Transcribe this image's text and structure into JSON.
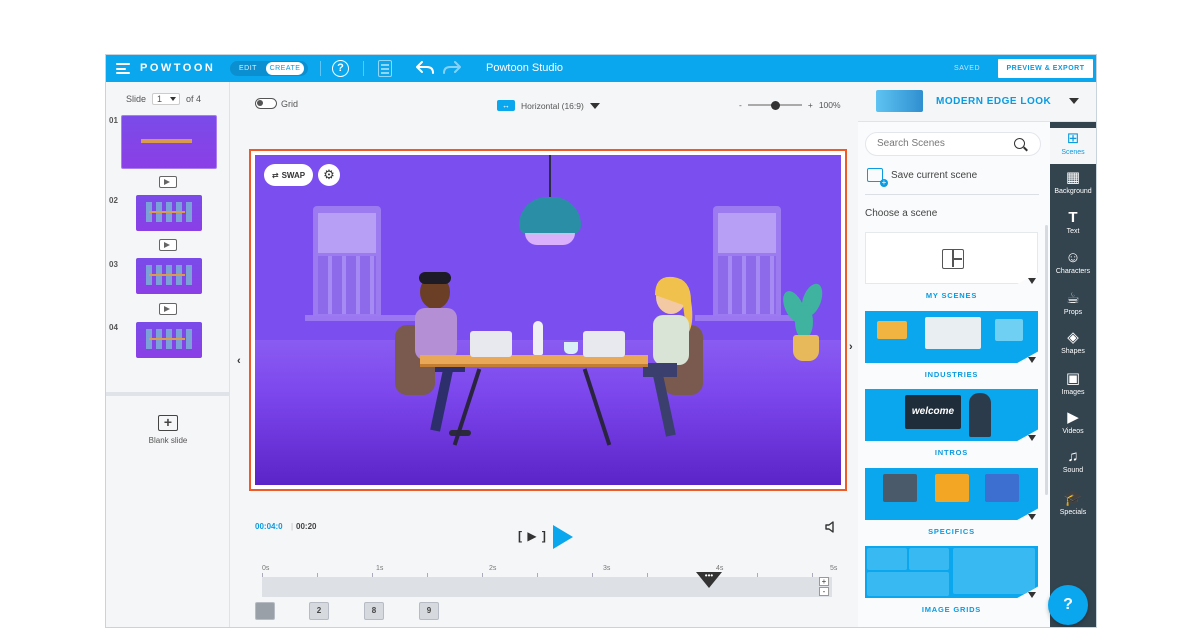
{
  "topbar": {
    "logo": "POWTOON",
    "mode_edit": "EDIT",
    "mode_create": "CREATE",
    "title": "Powtoon Studio",
    "saved": "SAVED",
    "export": "PREVIEW & EXPORT"
  },
  "slides_panel": {
    "label": "Slide",
    "current": "1",
    "of": "of 4",
    "slides": [
      {
        "number": "01"
      },
      {
        "number": "02"
      },
      {
        "number": "03"
      },
      {
        "number": "04"
      }
    ],
    "blank_slide": "Blank slide"
  },
  "canvas": {
    "grid_label": "Grid",
    "aspect_label": "Horizontal (16:9)",
    "zoom_minus": "-",
    "zoom_plus": "+",
    "zoom_value": "100%",
    "zoom_level": 0.5,
    "swap_label": "SWAP"
  },
  "timeline": {
    "current_time": "00:04:0",
    "separator": "|",
    "total_time": "00:20",
    "frame_label": "[ ▶ ]",
    "ruler": [
      "0s",
      "1s",
      "2s",
      "3s",
      "4s",
      "5s"
    ],
    "playhead_label": "•••",
    "playhead_position_s": 4.0,
    "zoom_in": "+",
    "zoom_out": "-",
    "layers": [
      "",
      "2",
      "8",
      "9"
    ]
  },
  "style": {
    "name": "MODERN EDGE LOOK"
  },
  "scenes_panel": {
    "search_placeholder": "Search Scenes",
    "save_current": "Save current scene",
    "choose_label": "Choose a scene",
    "categories": [
      {
        "label": "MY SCENES"
      },
      {
        "label": "INDUSTRIES"
      },
      {
        "label": "INTROS"
      },
      {
        "label": "SPECIFICS"
      },
      {
        "label": "IMAGE GRIDS"
      }
    ],
    "intro_banner": "welcome"
  },
  "toolbar": {
    "items": [
      {
        "label": "Scenes",
        "icon": "scenes-icon",
        "glyph": "⊞"
      },
      {
        "label": "Background",
        "icon": "background-icon",
        "glyph": "▦"
      },
      {
        "label": "Text",
        "icon": "text-icon",
        "glyph": "T"
      },
      {
        "label": "Characters",
        "icon": "characters-icon",
        "glyph": "☺"
      },
      {
        "label": "Props",
        "icon": "props-icon",
        "glyph": "☕"
      },
      {
        "label": "Shapes",
        "icon": "shapes-icon",
        "glyph": "◈"
      },
      {
        "label": "Images",
        "icon": "images-icon",
        "glyph": "▣"
      },
      {
        "label": "Videos",
        "icon": "videos-icon",
        "glyph": "▶"
      },
      {
        "label": "Sound",
        "icon": "sound-icon",
        "glyph": "♫"
      },
      {
        "label": "Specials",
        "icon": "specials-icon",
        "glyph": "🎓"
      }
    ]
  },
  "help_fab": "?",
  "colors": {
    "brand_blue": "#0aa6ee",
    "toolbar_dark": "#34444f",
    "selection_orange": "#ef5a27",
    "stage_purple": "#7b4ef0"
  }
}
